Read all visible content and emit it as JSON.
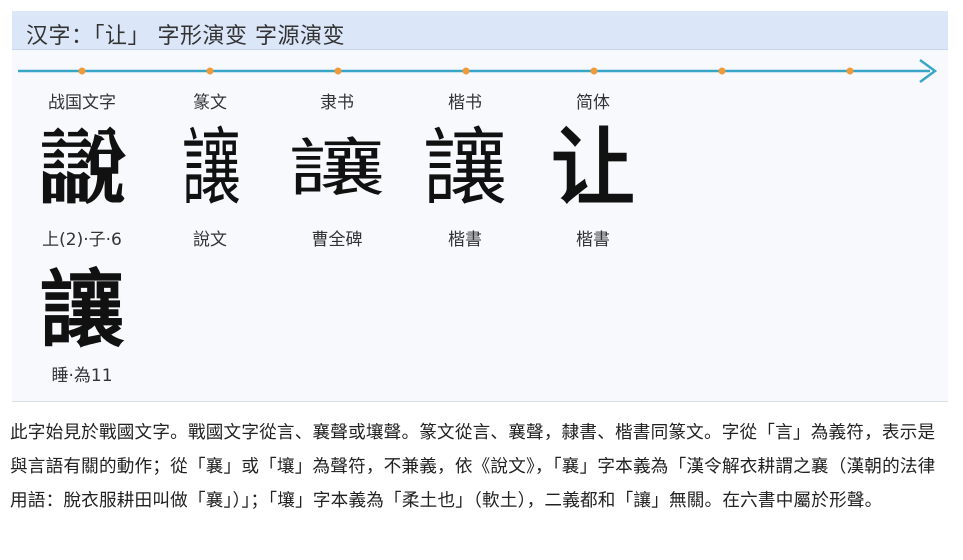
{
  "title": "汉字：「让」 字形演变 字源演变",
  "timeline": {
    "color": "#3aa6c7",
    "marker_color": "#f09a3a",
    "marker_count": 7
  },
  "entries": [
    {
      "era": "战国文字",
      "glyph": "𧭚",
      "source": "上(2)·子·6"
    },
    {
      "era": "篆文",
      "glyph": "讓",
      "source": "說文"
    },
    {
      "era": "隶书",
      "glyph": "讓",
      "source": "曹全碑"
    },
    {
      "era": "楷书",
      "glyph": "讓",
      "source": "楷書"
    },
    {
      "era": "简体",
      "glyph": "让",
      "source": "楷書"
    },
    {
      "era": "",
      "glyph": "讓",
      "source": "睡·為11"
    }
  ],
  "description": "此字始見於戰國文字。戰國文字從言、襄聲或壤聲。篆文從言、襄聲，隸書、楷書同篆文。字從「言」為義符，表示是與言語有關的動作；從「襄」或「壤」為聲符，不兼義，依《說文》，「襄」字本義為「漢令解衣耕謂之襄（漢朝的法律用語：脫衣服耕田叫做「襄」）」；「壤」字本義為「柔土也」（軟土），二義都和「讓」無關。在六書中屬於形聲。"
}
